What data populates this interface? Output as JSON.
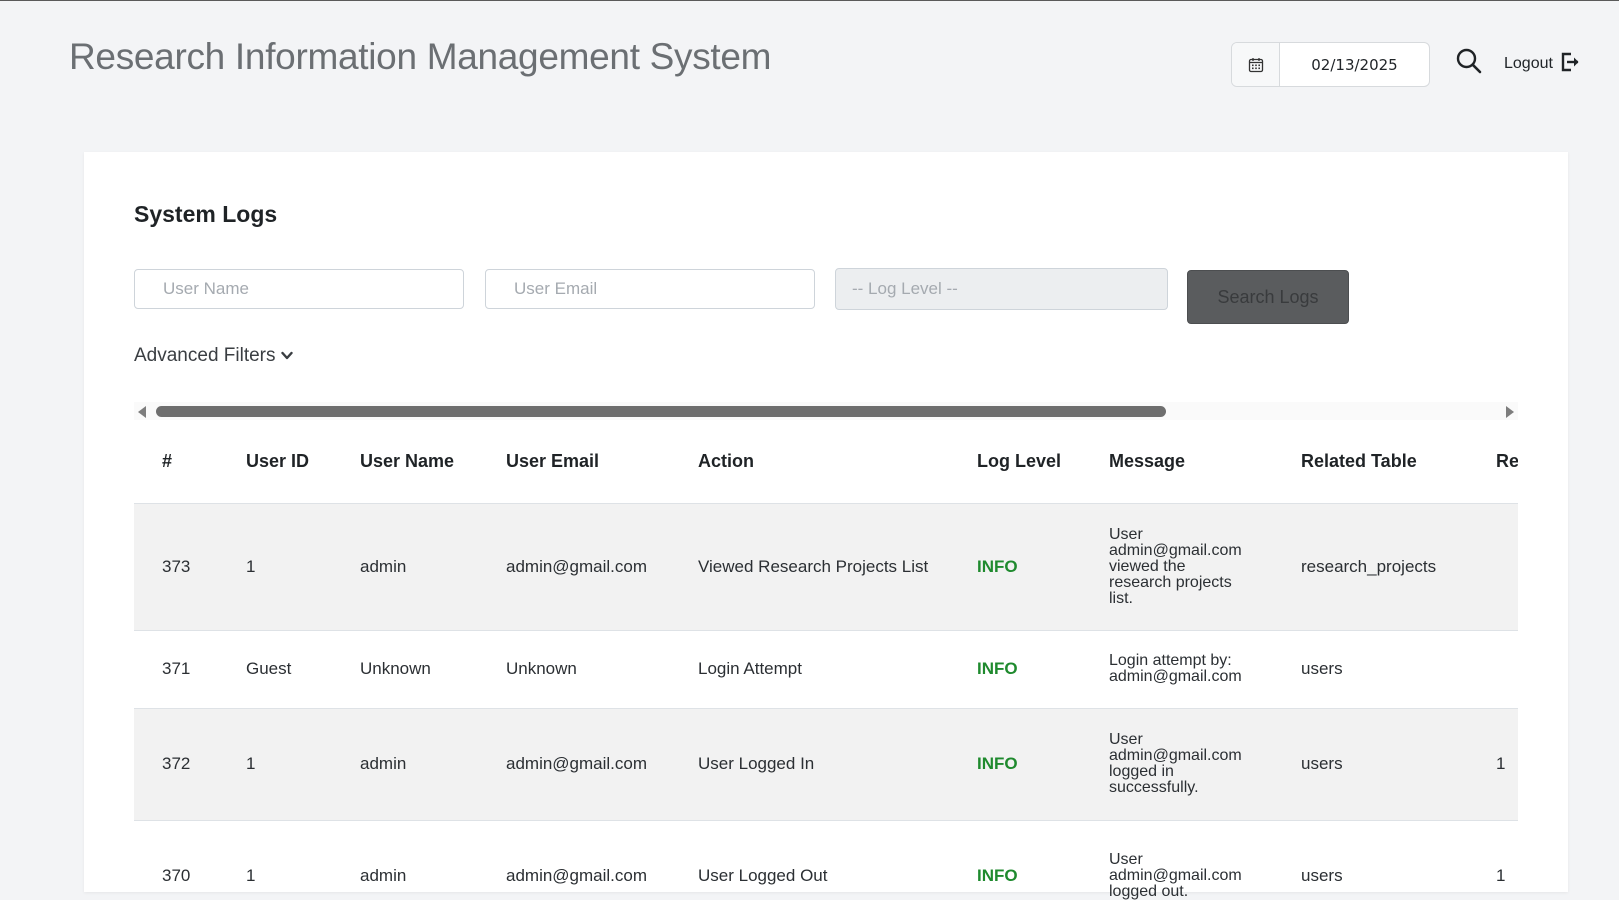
{
  "header": {
    "title": "Research Information Management System",
    "date": "02/13/2025",
    "logout_label": "Logout"
  },
  "card": {
    "title": "System Logs",
    "filters": {
      "user_name_placeholder": "User Name",
      "user_email_placeholder": "User Email",
      "log_level_selected": "-- Log Level --",
      "search_label": "Search Logs",
      "advanced_label": "Advanced Filters"
    }
  },
  "table": {
    "columns": [
      "#",
      "User ID",
      "User Name",
      "User Email",
      "Action",
      "Log Level",
      "Message",
      "Related Table",
      "Re"
    ],
    "rows": [
      {
        "id": "373",
        "user_id": "1",
        "user_name": "admin",
        "user_email": "admin@gmail.com",
        "action": "Viewed Research Projects List",
        "level": "INFO",
        "message": "User admin@gmail.com viewed the research projects list.",
        "related_table": "research_projects",
        "related_id": ""
      },
      {
        "id": "371",
        "user_id": "Guest",
        "user_name": "Unknown",
        "user_email": "Unknown",
        "action": "Login Attempt",
        "level": "INFO",
        "message": "Login attempt by: admin@gmail.com",
        "related_table": "users",
        "related_id": ""
      },
      {
        "id": "372",
        "user_id": "1",
        "user_name": "admin",
        "user_email": "admin@gmail.com",
        "action": "User Logged In",
        "level": "INFO",
        "message": "User admin@gmail.com logged in successfully.",
        "related_table": "users",
        "related_id": "1"
      },
      {
        "id": "370",
        "user_id": "1",
        "user_name": "admin",
        "user_email": "admin@gmail.com",
        "action": "User Logged Out",
        "level": "INFO",
        "message": "User admin@gmail.com logged out.",
        "related_table": "users",
        "related_id": "1"
      }
    ]
  },
  "colors": {
    "info_level": "#1f8a2e",
    "button_bg": "#5a5c5e"
  }
}
